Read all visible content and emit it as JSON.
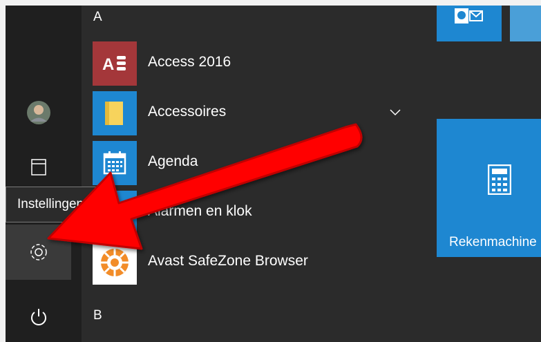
{
  "letters": {
    "a": "A",
    "b": "B"
  },
  "apps": [
    {
      "label": "Access 2016",
      "icon": "access-icon",
      "color": "#a4373a"
    },
    {
      "label": "Accessoires",
      "icon": "folder-icon",
      "color": "#1e87d1"
    },
    {
      "label": "Agenda",
      "icon": "calendar-icon",
      "color": "#1e87d1"
    },
    {
      "label": "Alarmen en klok",
      "icon": "alarm-clock-icon",
      "color": "#1e87d1"
    },
    {
      "label": "Avast SafeZone Browser",
      "icon": "avast-browser-icon",
      "color": "#ffffff"
    }
  ],
  "tooltip": "Instellingen",
  "tiles": {
    "calculator_label": "Rekenmachine",
    "accent": "#1e87d1"
  },
  "rail": {
    "icons": [
      "user-avatar",
      "file-explorer-icon",
      "settings-gear-icon",
      "power-icon"
    ]
  },
  "arrow_color": "#ff0000"
}
